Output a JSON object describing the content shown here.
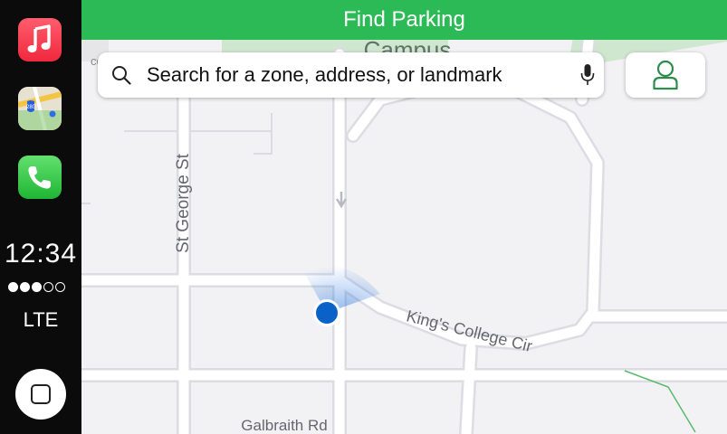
{
  "header": {
    "title": "Find Parking"
  },
  "search": {
    "placeholder": "Search for a zone, address, or landmark"
  },
  "dock": {
    "apps": [
      {
        "name": "Music",
        "icon": "music-note-icon"
      },
      {
        "name": "Maps",
        "icon": "maps-icon"
      },
      {
        "name": "Phone",
        "icon": "phone-icon"
      }
    ],
    "time": "12:34",
    "signal_bars": 3,
    "signal_total": 5,
    "network": "LTE"
  },
  "map": {
    "labels": {
      "campus": "Campus",
      "st_george": "St George St",
      "kings_college": "King's College Cir",
      "galbraith": "Galbraith Rd",
      "coop": "coo",
      "route_shield": "280"
    }
  },
  "colors": {
    "accent": "#2cba57",
    "location_dot": "#0a62c9",
    "dock_bg": "#0b0b0b"
  }
}
